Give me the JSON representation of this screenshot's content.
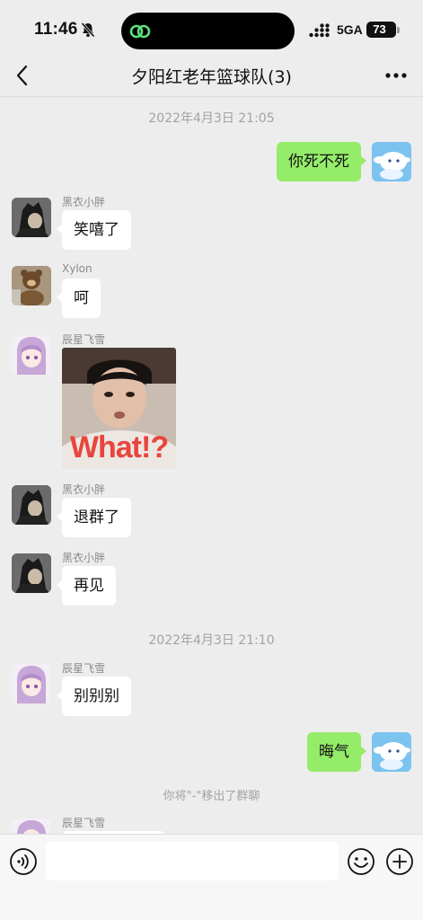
{
  "status_bar": {
    "time": "11:46",
    "network": "5GA",
    "battery": "73",
    "battery_level": 0.73
  },
  "header": {
    "title": "夕阳红老年篮球队(3)",
    "back_icon": "chevron-left-icon",
    "more_icon": "more-dots-icon"
  },
  "messages": {
    "ts1": "2022年4月3日 21:05",
    "m1_text": "你死不死",
    "m2_sender": "黑衣小胖",
    "m2_text": "笑嘻了",
    "m3_sender": "Xylon",
    "m3_text": "呵",
    "m4_sender": "辰星飞雪",
    "m4_sticker_caption": "What!?",
    "m5_sender": "黑衣小胖",
    "m5_text": "退群了",
    "m6_sender": "黑衣小胖",
    "m6_text": "再见",
    "ts2": "2022年4月3日 21:10",
    "m7_sender": "辰星飞雪",
    "m7_text": "别别别",
    "m8_text": "晦气",
    "system_notice": "你将\"-\"移出了群聊",
    "m9_sender": "辰星飞雪"
  },
  "input_bar": {
    "value": "",
    "voice_icon": "voice-icon",
    "emoji_icon": "emoji-icon",
    "plus_icon": "plus-icon"
  },
  "colors": {
    "background": "#ededed",
    "outgoing_bubble": "#95ec69",
    "incoming_bubble": "#ffffff",
    "sticker_text": "#e8453c"
  }
}
